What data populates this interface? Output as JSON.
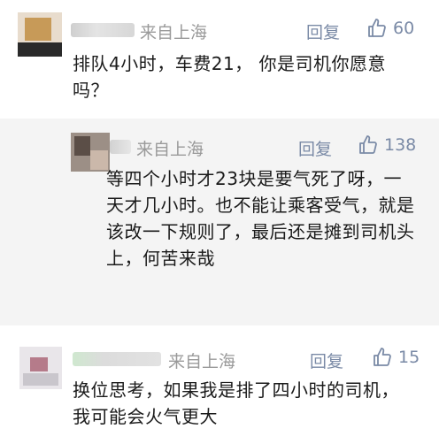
{
  "comments": [
    {
      "location": "来自上海",
      "reply_label": "回复",
      "likes": "60",
      "text": "排队4小时，车费21， 你是司机你愿意吗？"
    },
    {
      "location": "来自上海",
      "reply_label": "回复",
      "likes": "138",
      "text": "等四个小时才23块是要气死了呀，一天才几小时。也不能让乘客受气，就是该改一下规则了，最后还是摊到司机头上，何苦来哉"
    },
    {
      "location": "来自上海",
      "reply_label": "回复",
      "likes": "15",
      "text": "换位思考，如果我是排了四小时的司机，我可能会火气更大"
    }
  ],
  "colors": {
    "accent": "#7a8aa6",
    "location": "#9a9a9a",
    "alt_background": "#f4f4f4"
  },
  "icons": {
    "like": "thumbs-up-icon"
  }
}
